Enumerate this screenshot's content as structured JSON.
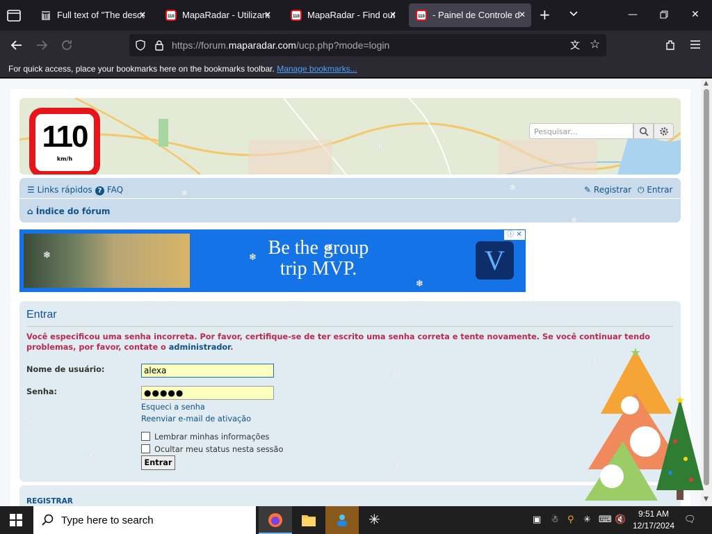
{
  "browser": {
    "tabs": [
      {
        "title": "Full text of \"The descen",
        "icon": "archive-icon"
      },
      {
        "title": "MapaRadar - Utilizando",
        "icon": "maparadar-favicon"
      },
      {
        "title": "MapaRadar - Find out th",
        "icon": "maparadar-favicon"
      },
      {
        "title": "- Painel de Controle do",
        "icon": "maparadar-favicon",
        "active": true
      }
    ],
    "url_prefix": "https://forum.",
    "url_domain": "maparadar.com",
    "url_path": "/ucp.php?mode=login",
    "bookmarks_text": "For quick access, place your bookmarks here on the bookmarks toolbar.",
    "bookmarks_link": "Manage bookmarks..."
  },
  "header": {
    "logo_number": "110",
    "logo_unit": "km/h",
    "search_placeholder": "Pesquisar..."
  },
  "nav": {
    "quick_links": "Links rápidos",
    "faq": "FAQ",
    "register": "Registrar",
    "login": "Entrar",
    "breadcrumb": "Índice do fórum"
  },
  "ad": {
    "line1": "Be the group",
    "line2": "trip MVP.",
    "logo": "V"
  },
  "login": {
    "title": "Entrar",
    "error_text": "Você especificou uma senha incorreta. Por favor, certifique-se de ter escrito uma senha correta e tente novamente. Se você continuar tendo problemas, por favor, contate o",
    "error_link": "administrador",
    "error_end": ".",
    "username_label": "Nome de usuário:",
    "username_value": "alexa",
    "password_label": "Senha:",
    "password_value": "●●●●●",
    "forgot_link": "Esqueci a senha",
    "resend_link": "Reenviar e-mail de ativação",
    "remember_label": "Lembrar minhas informações",
    "hide_label": "Ocultar meu status nesta sessão",
    "submit_label": "Entrar"
  },
  "register_section": {
    "heading": "REGISTRAR"
  },
  "taskbar": {
    "search_placeholder": "Type here to search",
    "time": "9:51 AM",
    "date": "12/17/2024"
  },
  "colors": {
    "forum_blue": "#105289",
    "error_red": "#bc2a4d",
    "panel_bg": "#e1ebf2",
    "nav_bg": "#cadceb",
    "ad_blue": "#1473e6",
    "logo_red": "#e8141a"
  }
}
